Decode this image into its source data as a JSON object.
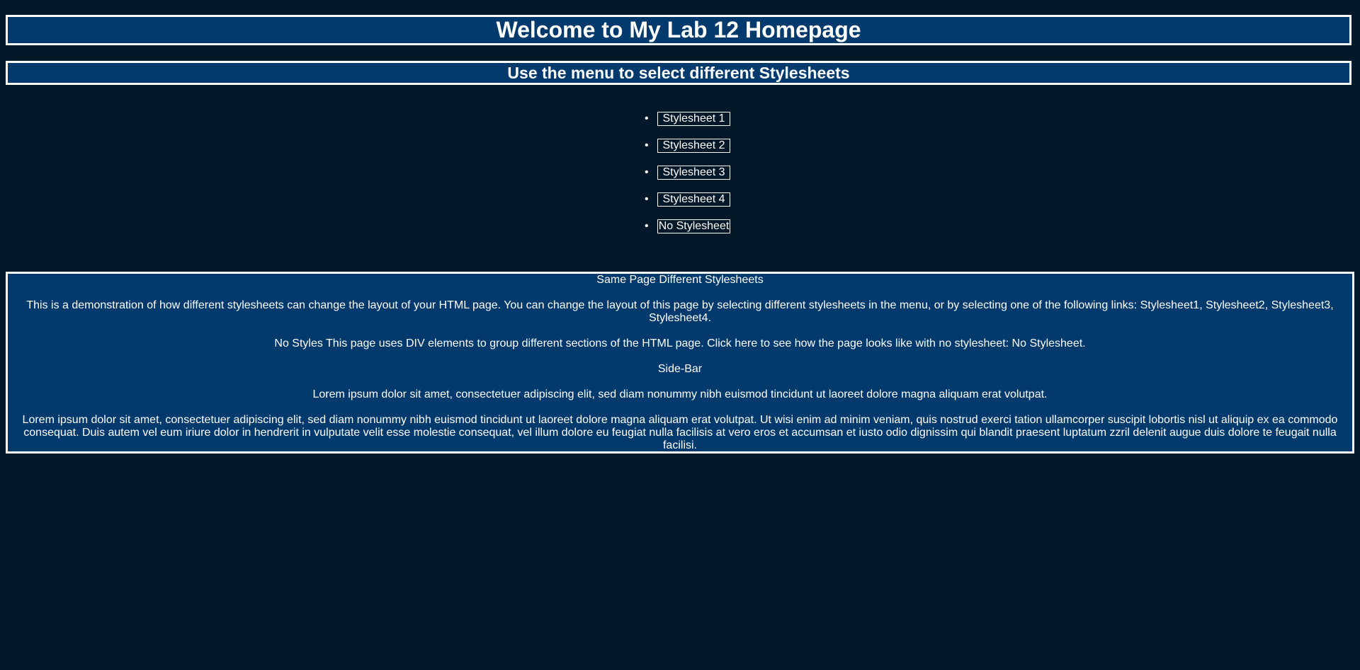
{
  "header": {
    "title": "Welcome to My Lab 12 Homepage"
  },
  "subheader": {
    "title": "Use the menu to select different Stylesheets"
  },
  "menu": {
    "items": [
      {
        "label": "Stylesheet 1"
      },
      {
        "label": "Stylesheet 2"
      },
      {
        "label": "Stylesheet 3"
      },
      {
        "label": "Stylesheet 4"
      },
      {
        "label": "No Stylesheet"
      }
    ]
  },
  "content": {
    "heading": "Same Page Different Stylesheets",
    "intro": "This is a demonstration of how different stylesheets can change the layout of your HTML page. You can change the layout of this page by selecting different stylesheets in the menu, or by selecting one of the following links:",
    "links": [
      "Stylesheet1",
      "Stylesheet2",
      "Stylesheet3",
      "Stylesheet4"
    ],
    "no_styles_heading": "No Styles",
    "no_styles_text": "This page uses DIV elements to group different sections of the HTML page. Click here to see how the page looks like with no stylesheet:",
    "no_styles_link": "No Stylesheet",
    "sidebar_heading": "Side-Bar",
    "lorem_short": "Lorem ipsum dolor sit amet, consectetuer adipiscing elit, sed diam nonummy nibh euismod tincidunt ut laoreet dolore magna aliquam erat volutpat.",
    "lorem_long": "Lorem ipsum dolor sit amet, consectetuer adipiscing elit, sed diam nonummy nibh euismod tincidunt ut laoreet dolore magna aliquam erat volutpat. Ut wisi enim ad minim veniam, quis nostrud exerci tation ullamcorper suscipit lobortis nisl ut aliquip ex ea commodo consequat. Duis autem vel eum iriure dolor in hendrerit in vulputate velit esse molestie consequat, vel illum dolore eu feugiat nulla facilisis at vero eros et accumsan et iusto odio dignissim qui blandit praesent luptatum zzril delenit augue duis dolore te feugait nulla facilisi."
  },
  "colors": {
    "background": "#031829",
    "panel": "#023a6e",
    "border": "#ffffff",
    "text": "#ffffff"
  }
}
